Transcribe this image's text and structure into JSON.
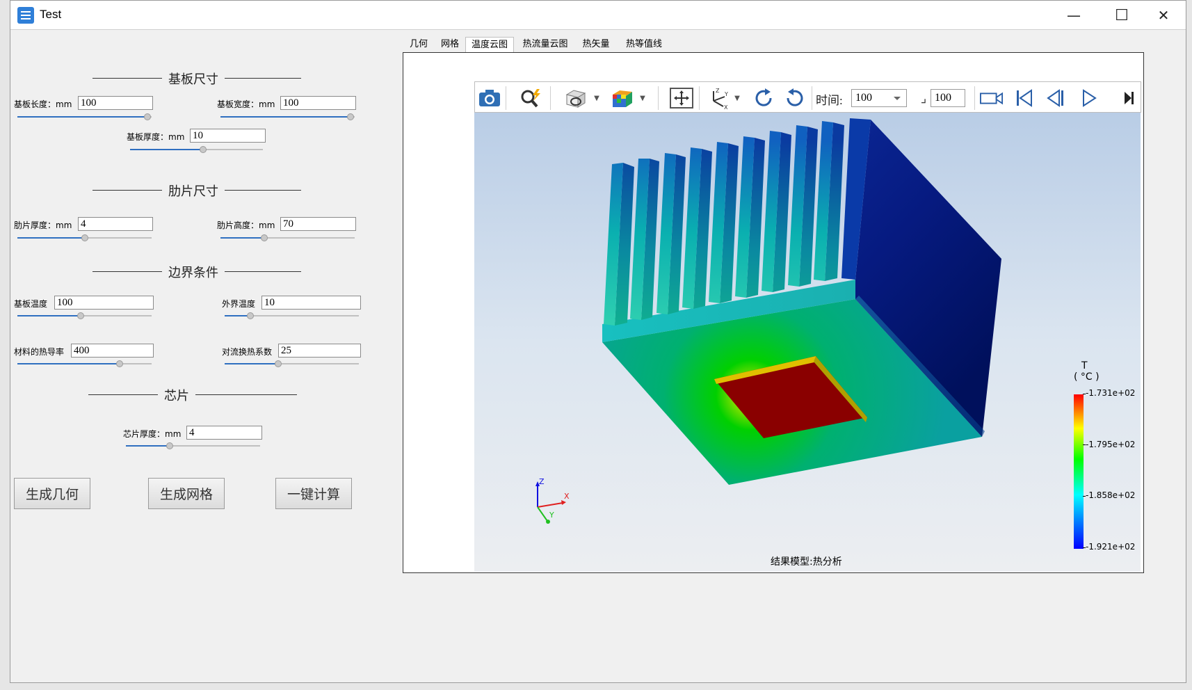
{
  "window": {
    "title": "Test",
    "minimize": "—",
    "maximize": "☐",
    "close": "✕"
  },
  "left_panel": {
    "substrate_section": "基板尺寸",
    "substrate_length": {
      "label": "基板长度：mm",
      "value": "100",
      "slider": 0.98
    },
    "substrate_width": {
      "label": "基板宽度：mm",
      "value": "100",
      "slider": 0.98
    },
    "substrate_thickness": {
      "label": "基板厚度：mm",
      "value": "10",
      "slider": 0.55
    },
    "fin_section": "肋片尺寸",
    "fin_thickness": {
      "label": "肋片厚度：mm",
      "value": "4",
      "slider": 0.5
    },
    "fin_height": {
      "label": "肋片高度：mm",
      "value": "70",
      "slider": 0.33
    },
    "boundary_section": "边界条件",
    "substrate_temp": {
      "label": "基板温度",
      "value": "100",
      "slider": 0.48
    },
    "ambient_temp": {
      "label": "外界温度",
      "value": "10",
      "slider": 0.2
    },
    "conductivity": {
      "label": "材料的热导率",
      "value": "400",
      "slider": 0.77
    },
    "convection": {
      "label": "对流换热系数",
      "value": "25",
      "slider": 0.4
    },
    "chip_section": "芯片",
    "chip_thickness": {
      "label": "芯片厚度：mm",
      "value": "4",
      "slider": 0.33
    },
    "buttons": {
      "gen_geometry": "生成几何",
      "gen_mesh": "生成网格",
      "compute": "一键计算"
    }
  },
  "tabs": [
    "几何",
    "网格",
    "温度云图",
    "热流量云图",
    "热矢量",
    "热等值线"
  ],
  "active_tab": "温度云图",
  "toolbar": {
    "time_label": "时间:",
    "time_value": "100",
    "step_value": "100",
    "icons": [
      "camera-icon",
      "zoom-icon",
      "display-mode-icon",
      "cube-color-icon",
      "fit-view-icon",
      "axes-icon",
      "rotate-cw-icon",
      "rotate-ccw-icon",
      "record-icon",
      "first-frame-icon",
      "prev-frame-icon",
      "play-icon",
      "last-frame-icon"
    ]
  },
  "legend": {
    "title": "T",
    "unit": "( °C )",
    "max": "-1.731e+02",
    "v2": "-1.795e+02",
    "v3": "-1.858e+02",
    "min": "-1.921e+02",
    "colors": [
      "#ff0000",
      "#ffff00",
      "#00ff00",
      "#00ffff",
      "#0000ff"
    ]
  },
  "axis_triad": {
    "z": "Z",
    "x": "X",
    "y": "Y"
  },
  "result_model": "结果模型:热分析"
}
